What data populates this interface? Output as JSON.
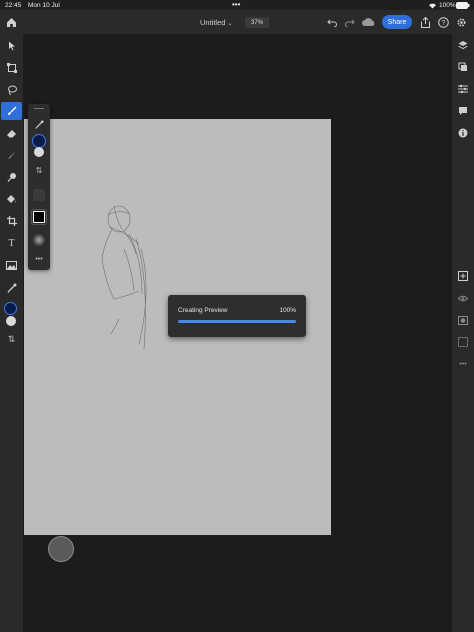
{
  "status": {
    "time": "22:45",
    "date": "Mon 10 Jul",
    "battery": "100%"
  },
  "header": {
    "title": "Untitled",
    "zoom": "37%",
    "share_label": "Share"
  },
  "dialog": {
    "label": "Creating Preview",
    "percent_text": "100%",
    "progress": 1.0
  },
  "colors": {
    "accent": "#2f6fd9",
    "primary_swatch": "#0a1a4a",
    "secondary_swatch": "#d9d9d9"
  },
  "icons": {
    "left": [
      "select-icon",
      "transform-icon",
      "lasso-icon",
      "brush-icon",
      "eraser-icon",
      "smudge-icon",
      "liquify-icon",
      "fill-icon",
      "crop-icon",
      "text-icon",
      "image-icon",
      "eyedropper-icon"
    ],
    "right": [
      "layers-icon",
      "layer-props-icon",
      "adjustments-icon",
      "comments-icon",
      "info-icon",
      "add-layer-icon",
      "visibility-icon",
      "mask-icon",
      "more-layer-icon"
    ]
  }
}
